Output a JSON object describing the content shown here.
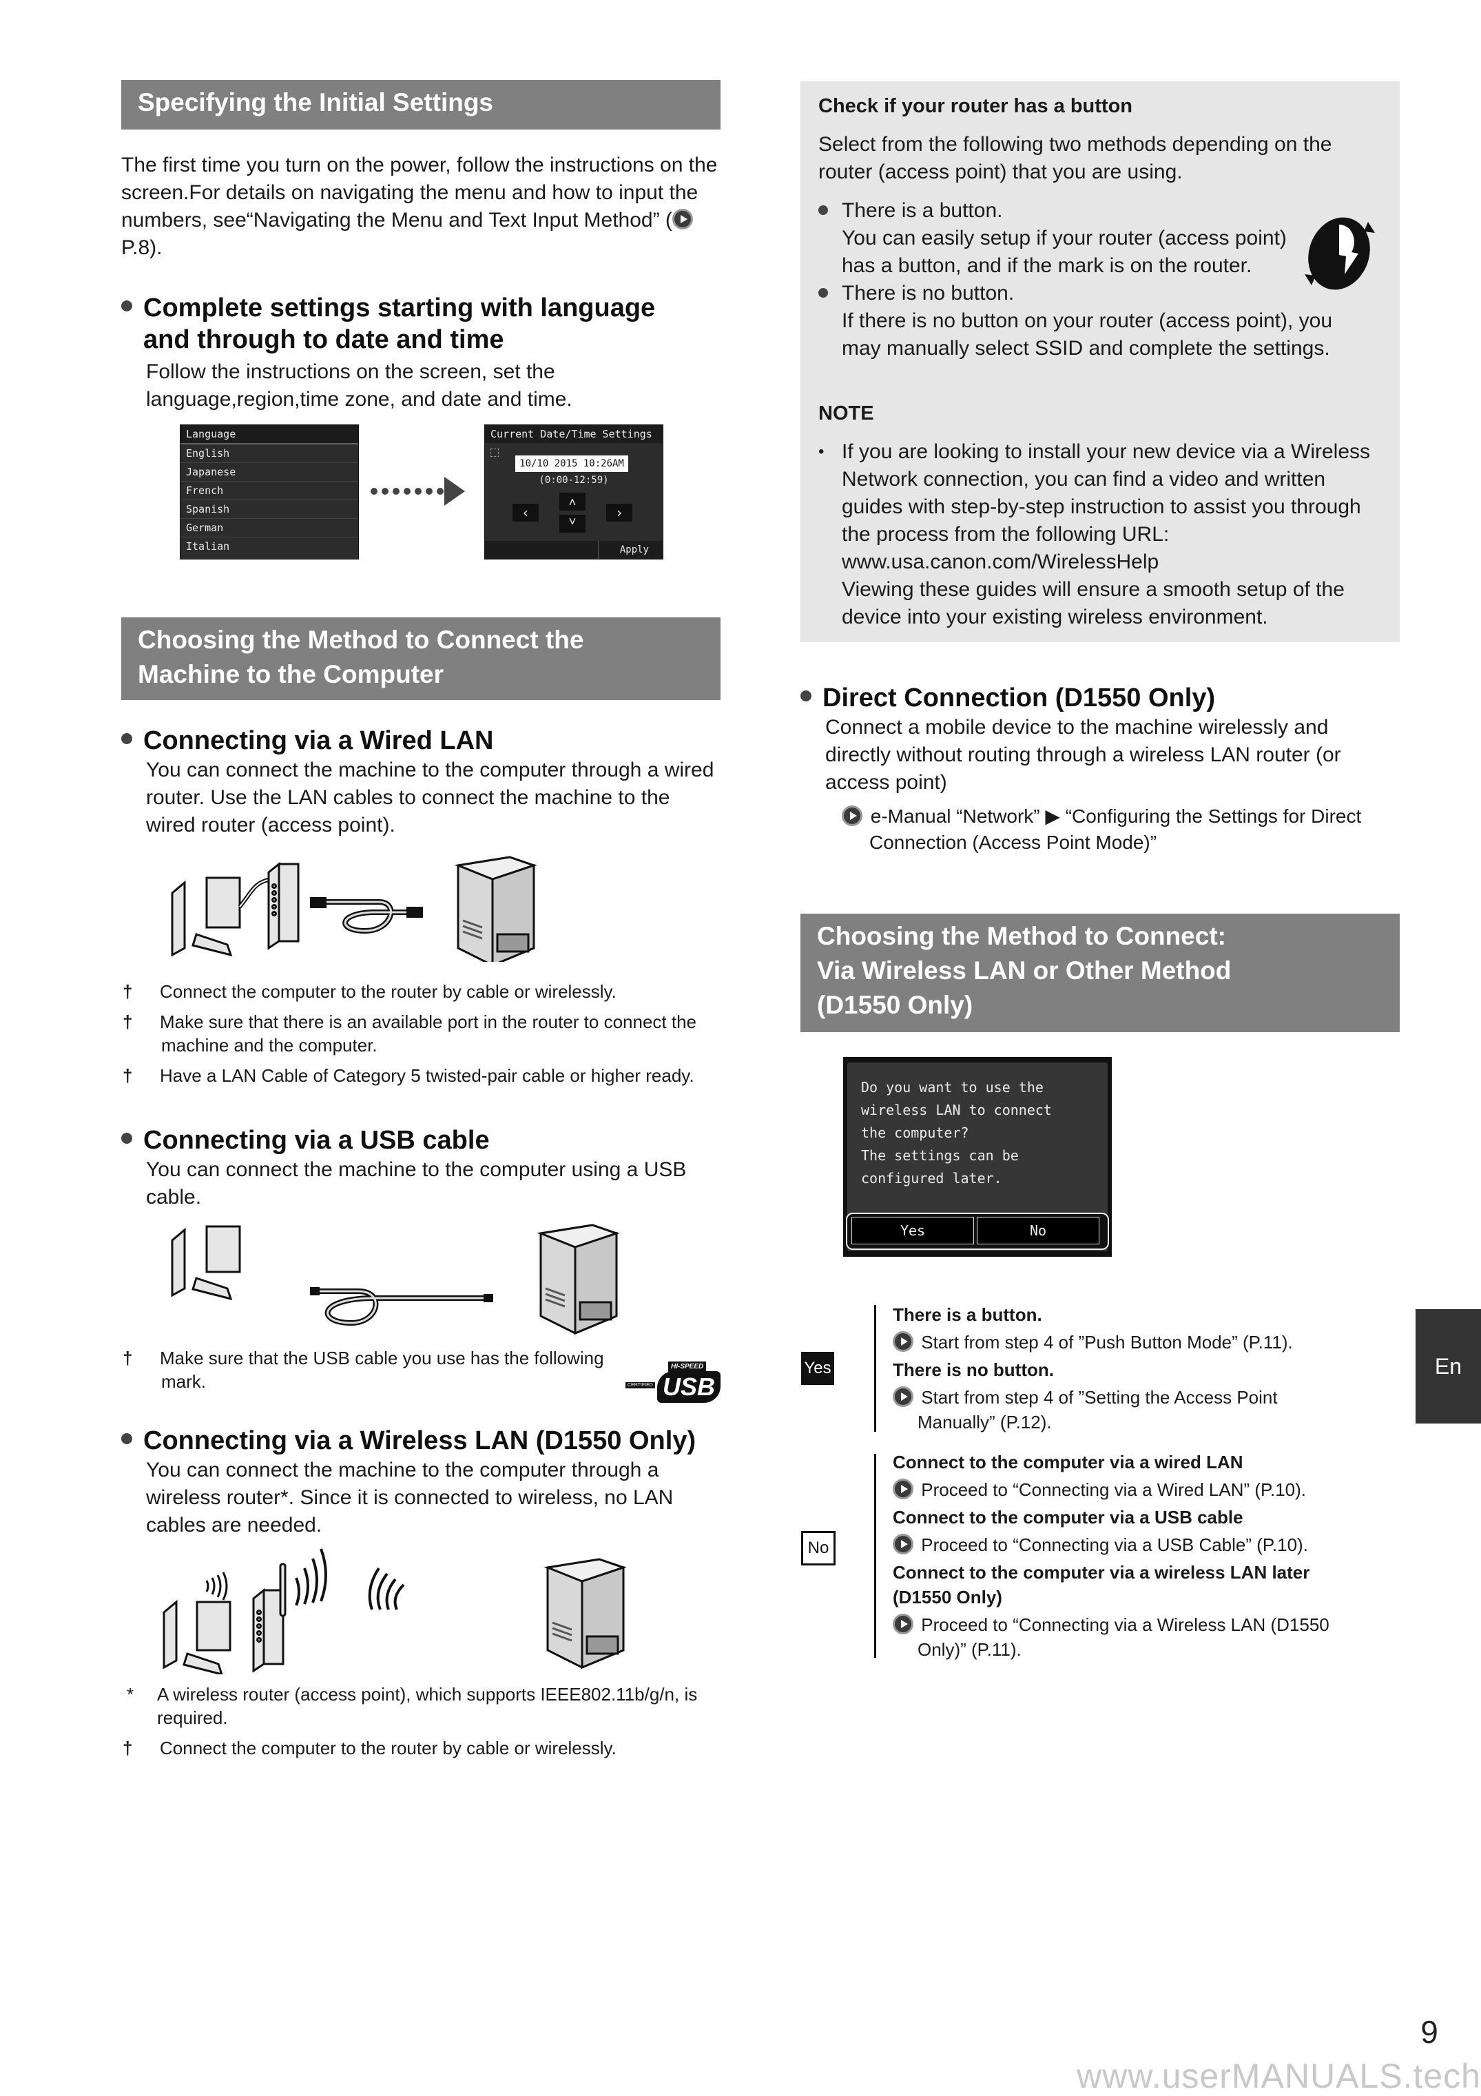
{
  "left": {
    "section1": {
      "title": "Specifying the Initial Settings",
      "intro": "The first time you turn on the power, follow the instructions on the screen.For details on navigating the menu and how to input the numbers, see“Navigating the Menu and Text Input Method” (",
      "intro_ref": "P.8).",
      "subhead_line1": "Complete settings starting with language",
      "subhead_line2": "and through to date and time",
      "subtext": "Follow the instructions on the screen, set the language,region,time zone, and date and time.",
      "lcd_language": {
        "title": "Language",
        "items": [
          "English",
          "Japanese",
          "French",
          "Spanish",
          "German",
          "Italian"
        ]
      },
      "lcd_datetime": {
        "title": "Current Date/Time Settings",
        "value": "10/10 2015 10:26AM",
        "range": "(0:00-12:59)",
        "left": "‹",
        "right": "›",
        "up": "˄",
        "down": "˅",
        "apply": "Apply"
      }
    },
    "section2": {
      "title_line1": "Choosing the Method to Connect the",
      "title_line2": "Machine to the Computer",
      "wired": {
        "heading": "Connecting via a Wired LAN",
        "text": "You can connect the machine to the computer through a wired router. Use the LAN cables to connect the machine to the wired router (access point).",
        "notes": [
          "Connect the computer to the router by cable or wirelessly.",
          "Make sure that there is an available port in the router to connect the machine and the computer.",
          "Have a LAN Cable of Category 5 twisted-pair cable or higher ready."
        ]
      },
      "usb": {
        "heading": "Connecting via a USB cable",
        "text": "You can connect the machine to the computer using a USB cable.",
        "notes": [
          "Make sure that the USB cable you use has the following mark."
        ],
        "logo_top": "HI-SPEED",
        "logo_main": "USB",
        "logo_side": "CERTIFIED"
      },
      "wireless": {
        "heading": "Connecting via a Wireless LAN (D1550 Only)",
        "text": "You can connect the machine to the computer through a wireless router*. Since it is connected to wireless, no LAN cables are needed.",
        "footnote_star": "A wireless router (access point), which supports IEEE802.11b/g/n, is required.",
        "notes": [
          "Connect the computer to the router by cable or wirelessly."
        ]
      },
      "dagger": "†",
      "star": "*"
    }
  },
  "right": {
    "router_box": {
      "title": "Check if your router has a button",
      "intro": "Select from the following two methods depending on the router (access point) that you are using.",
      "item1_title": "There is a button.",
      "item1_text": "You can easily setup if your router (access point) has a button, and if the mark is on the router.",
      "item2_title": "There is no button.",
      "item2_text": "If there is no button on your router (access point), you may manually select SSID and complete the settings.",
      "note_label": "NOTE",
      "note_text": "If you are looking to install your new device via a Wireless Network connection, you can find a video and written guides with step-by-step instruction to assist you through the process from the following URL:",
      "note_url": "www.usa.canon.com/WirelessHelp",
      "note_text2": "Viewing these guides will ensure a smooth setup of the device into your existing wireless environment."
    },
    "direct": {
      "heading": "Direct Connection (D1550 Only)",
      "text": "Connect a mobile device to the machine wirelessly and directly without routing through a wireless LAN router (or access point)",
      "ref": "e-Manual “Network” ▶ “Configuring the Settings for Direct Connection (Access Point Mode)”"
    },
    "section3": {
      "title_line1": "Choosing the Method to Connect:",
      "title_line2": "Via Wireless LAN or Other Method",
      "title_line3": "(D1550 Only)",
      "lcd": {
        "lines": [
          "Do you want to use the",
          "wireless LAN to connect",
          "the computer?",
          "The settings can be",
          "configured later."
        ],
        "yes": "Yes",
        "no": "No"
      },
      "yes_block": {
        "label": "Yes",
        "items": [
          {
            "title": "There is a button.",
            "ref": "Start from step 4 of ”Push Button Mode” (P.11)."
          },
          {
            "title": "There is no button.",
            "ref": "Start from step 4 of ”Setting the Access Point Manually” (P.12)."
          }
        ]
      },
      "no_block": {
        "label": "No",
        "items": [
          {
            "title": "Connect to the computer via a wired LAN",
            "ref": "Proceed to “Connecting via a Wired LAN” (P.10)."
          },
          {
            "title": "Connect to the computer via a USB cable",
            "ref": "Proceed to “Connecting via a USB Cable” (P.10)."
          },
          {
            "title": "Connect to the computer via a wireless LAN later (D1550 Only)",
            "ref": "Proceed to “Connecting via a Wireless LAN (D1550 Only)” (P.11)."
          }
        ]
      }
    }
  },
  "side_tab": "En",
  "page_number": "9",
  "watermark": "www.userMANUALS.tech"
}
